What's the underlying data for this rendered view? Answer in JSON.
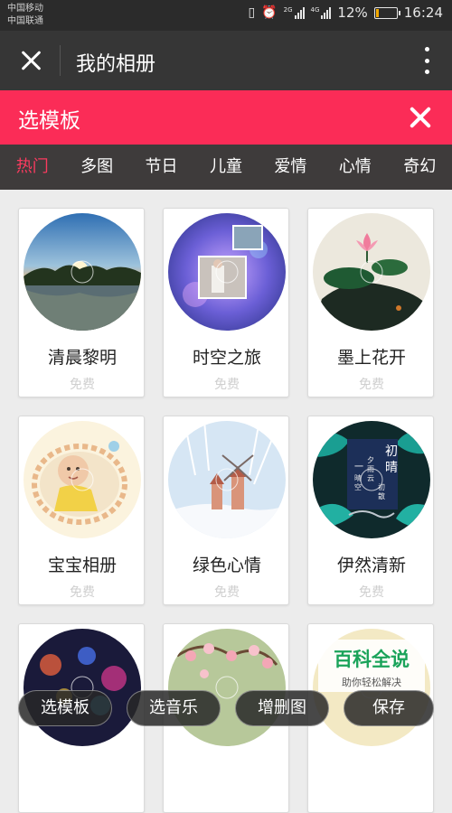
{
  "status": {
    "carrier1": "中国移动",
    "carrier2": "中国联通",
    "net1": "2G",
    "net2": "4G",
    "battery": "12%",
    "battery_level": 0.12,
    "time": "16:24",
    "icons": [
      "vibrate-icon",
      "alarm-icon",
      "signal-icon",
      "battery-icon"
    ]
  },
  "titlebar": {
    "title": "我的相册",
    "close_icon": "close-icon",
    "more_icon": "more-icon"
  },
  "panel": {
    "title": "选模板",
    "close_icon": "close-icon"
  },
  "tabs": [
    "热门",
    "多图",
    "节日",
    "儿童",
    "爱情",
    "心情",
    "奇幻"
  ],
  "active_tab": "热门",
  "accent_color": "#fb2c57",
  "templates": [
    {
      "name": "清晨黎明",
      "price": "免费"
    },
    {
      "name": "时空之旅",
      "price": "免费"
    },
    {
      "name": "墨上花开",
      "price": "免费"
    },
    {
      "name": "宝宝相册",
      "price": "免费"
    },
    {
      "name": "绿色心情",
      "price": "免费"
    },
    {
      "name": "伊然清新",
      "price": "免费"
    },
    {
      "name": "",
      "price": ""
    },
    {
      "name": "",
      "price": ""
    },
    {
      "name": "",
      "price": ""
    }
  ],
  "thumb_texts": {
    "yiran": [
      "初",
      "晴",
      "一",
      "夕",
      "雨",
      "云",
      "晴",
      "空",
      "初",
      "散"
    ]
  },
  "bottom_buttons": [
    "选模板",
    "选音乐",
    "增删图",
    "保存"
  ],
  "watermark": {
    "title": "百科全说",
    "subtitle": "助你轻松解决"
  }
}
